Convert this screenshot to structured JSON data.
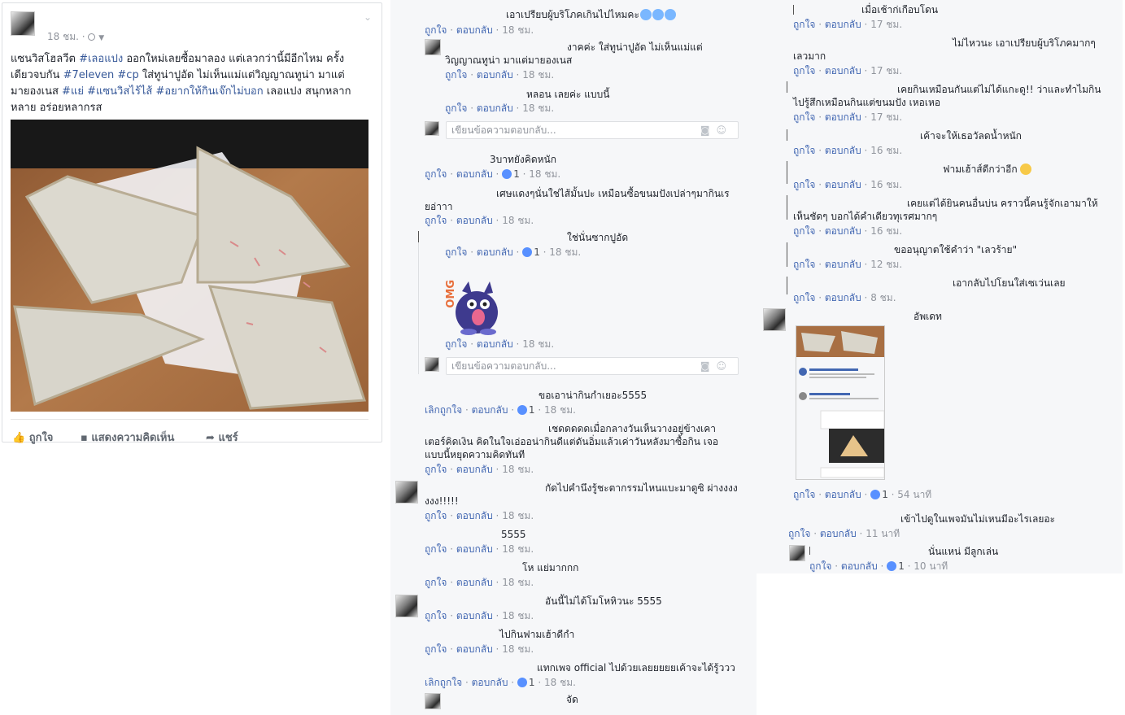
{
  "post": {
    "time": "18 ชม.",
    "privacy_icon": "globe-icon",
    "text_parts": [
      {
        "t": "แซนวิสโฮลวีต ",
        "tag": false
      },
      {
        "t": "#เลอแปง",
        "tag": true
      },
      {
        "t": " ออกใหม่เลยซื้อมาลอง แต่เลวกว่านี้มีอีกไหม ครั้งเดียวจบกัน ",
        "tag": false
      },
      {
        "t": "#7eleven",
        "tag": true
      },
      {
        "t": " ",
        "tag": false
      },
      {
        "t": "#cp",
        "tag": true
      },
      {
        "t": " ใส่ทูน่าปูอัด ไม่เห็นแม่แต่วิญญาณทูน่า มาแต่มายองเนส ",
        "tag": false
      },
      {
        "t": "#แย่",
        "tag": true
      },
      {
        "t": " ",
        "tag": false
      },
      {
        "t": "#แซนวิสไร้ไส้",
        "tag": true
      },
      {
        "t": " ",
        "tag": false
      },
      {
        "t": "#อยากให้กินเจ๊กไม่บอก",
        "tag": true
      },
      {
        "t": " เลอแปง สนุกหลากหลาย อร่อยหลากรส",
        "tag": false
      }
    ],
    "actions": {
      "like": "ถูกใจ",
      "comment": "แสดงความคิดเห็น",
      "share": "แชร์"
    }
  },
  "labels": {
    "like": "ถูกใจ",
    "unlike": "เลิกถูกใจ",
    "reply": "ตอบกลับ",
    "sep": "·",
    "reply_placeholder": "เขียนข้อความตอบกลับ..."
  },
  "col2": [
    {
      "text": "เอาเปรียบผู้บริโภคเกินไปไหมคะ",
      "time": "18 ชม.",
      "emoji": 3
    },
    {
      "text": "งาคค่ะ ใส่ทูน่าปูอัด ไม่เห็นแม่แต่วิญญาณทูน่า มาแต่มายองเนส",
      "time": "18 ชม."
    },
    {
      "text": "หลอน เลยค่ะ แบบนี้",
      "time": "18 ชม."
    },
    {
      "text": "3บาทยังคิดหนัก",
      "time": "18 ชม.",
      "reactions": "1"
    },
    {
      "text": "เศษแดงๆนั่นใช่ไส้มั้นปะ เหมือนซื้อขนมปังเปล่าๆมากินเรยอ่าาา",
      "time": "18 ชม."
    },
    {
      "text": "ใช่นั่นซากปูอัด",
      "time": "18 ชม.",
      "reactions": "1"
    },
    {
      "sticker": "OMG",
      "time": "18 ชม."
    },
    {
      "text": "ขอเอาน่ากินกำเยอะ5555",
      "time": "18 ชม.",
      "reactions": "1",
      "liked": true
    },
    {
      "text": "เชดดดดดเมื่อกลางวันเห็นวางอยู่ข้างเคาเตอร์คิดเงิน คิดในใจเอ่ออน่ากินดีแต่ดันอิ่มแล้วเค่าวันหลังมาซื้อกิน เจอแบบนี้หยุดความคิดทันที",
      "time": "18 ชม."
    },
    {
      "text": "กัดไปคำนึงรู้ชะตากรรมไหนแบะมาดูซิ ผ่างงงงงงง!!!!!",
      "time": "18 ชม."
    },
    {
      "text": "5555",
      "time": "18 ชม."
    },
    {
      "text": "โห แย่มากกก",
      "time": "18 ชม."
    },
    {
      "text": "อันนี้ไม่ได้โมโหหิวนะ 5555",
      "time": "18 ชม."
    },
    {
      "text": "ไปกินฟามเฮ้าดีกำ",
      "time": "18 ชม."
    },
    {
      "text": "แทกเพจ official ไปด้วยเลยยยยยเค้าจะได้รู้ววว",
      "time": "18 ชม.",
      "reactions": "1",
      "liked": true
    },
    {
      "text": "จัด"
    }
  ],
  "col3": [
    {
      "text": "เมื่อเช้าก่เกือบโดน",
      "time": "17 ชม."
    },
    {
      "text": "ไม่ไหวนะ เอาเปรียบผู้บริโภคมากๆเลวมาก",
      "time": "17 ชม."
    },
    {
      "text": "เคยกินเหมือนกันแต่ไม่ได้แกะดู!! ว่าและทำไมกินไปรู้สึกเหมือนกินแต่ขนมปัง เหอเหอ",
      "time": "17 ชม."
    },
    {
      "text": "เค้าจะให้เธอวัลดน้ำหนัก",
      "time": "16 ชม."
    },
    {
      "text": "ฟามเฮ้าส์ดีกว่าอีก",
      "time": "16 ชม.",
      "laugh": true
    },
    {
      "text": "เคยแต่ได้ยินคนอื่นบ่น คราวนี้คนรู้จักเอามาให้เห็นชัดๆ บอกได้คำเดียวทุเรศมากๆ",
      "time": "16 ชม."
    },
    {
      "text": "ขออนุญาตใช้คำว่า \"เลวร้าย\"",
      "time": "12 ชม."
    },
    {
      "text": "เอากลับไปโยนใส่เซเว่นเลย",
      "time": "8 ชม."
    },
    {
      "text": "อัพเดท",
      "time": "54 นาที",
      "reactions": "1"
    },
    {
      "text": "เข้าไปดูในเพจมันไม่เหนมีอะไรเลยอะ",
      "time": "11 นาที"
    },
    {
      "text": "นั่นแหน่ มีลูกเล่น",
      "time": "10 นาที",
      "reactions": "1"
    }
  ],
  "colors": {
    "link": "#4267b2",
    "hashtag": "#365899",
    "meta": "#90949c",
    "panel": "#f6f7f9",
    "reaction": "#5890ff"
  }
}
